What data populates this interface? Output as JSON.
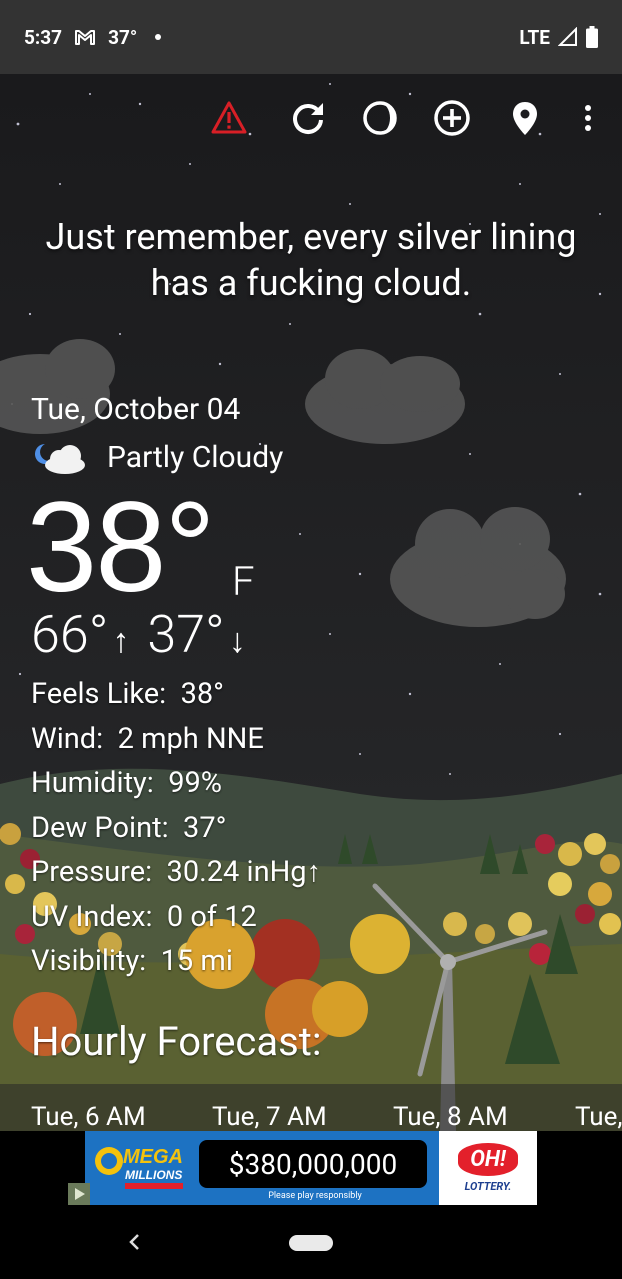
{
  "status_bar": {
    "time": "5:37",
    "temp": "37°",
    "network": "LTE",
    "icons": [
      "gmail-icon",
      "signal-icon",
      "battery-icon"
    ]
  },
  "toolbar": {
    "icons": [
      "alert-icon",
      "refresh-icon",
      "theme-icon",
      "add-location-icon",
      "location-pin-icon",
      "more-vert-icon"
    ]
  },
  "quote": "Just remember, every silver lining has a fucking cloud.",
  "current": {
    "date": "Tue, October 04",
    "condition": "Partly Cloudy",
    "temperature": "38°",
    "unit": "F",
    "high": "66°",
    "low": "37°",
    "details": [
      {
        "label": "Feels Like:",
        "value": "38°"
      },
      {
        "label": "Wind:",
        "value": "2 mph NNE"
      },
      {
        "label": "Humidity:",
        "value": "99%"
      },
      {
        "label": "Dew Point:",
        "value": "37°"
      },
      {
        "label": "Pressure:",
        "value": "30.24 inHg↑"
      },
      {
        "label": "UV Index:",
        "value": "0 of 12"
      },
      {
        "label": "Visibility:",
        "value": "15 mi"
      }
    ]
  },
  "hourly": {
    "title": "Hourly Forecast:",
    "hours": [
      "Tue, 6 AM",
      "Tue, 7 AM",
      "Tue, 8 AM",
      "Tue,"
    ]
  },
  "ad": {
    "brand_left": "MEGA MILLIONS",
    "amount": "$380,000,000",
    "note": "Please play responsibly",
    "brand_right": "OH!",
    "brand_right_sub": "LOTTERY."
  },
  "colors": {
    "alert": "#d81f26",
    "sky": "#1c1c1f",
    "ad_blue": "#1d72c2"
  }
}
